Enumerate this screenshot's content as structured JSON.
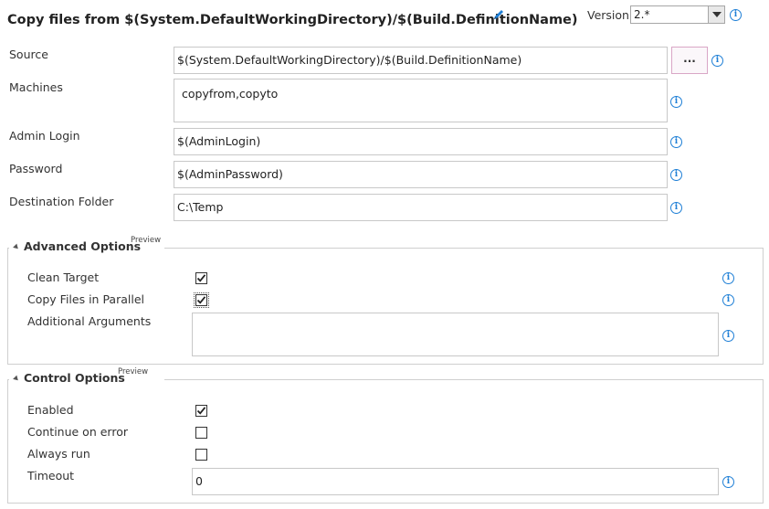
{
  "header": {
    "title": "Copy files from $(System.DefaultWorkingDirectory)/$(Build.DefinitionName)",
    "version_label": "Version",
    "version_value": "2.*"
  },
  "fields": {
    "source": {
      "label": "Source",
      "value": "$(System.DefaultWorkingDirectory)/$(Build.DefinitionName)",
      "browse_label": "..."
    },
    "machines": {
      "label": "Machines",
      "value": "copyfrom,copyto"
    },
    "admin_login": {
      "label": "Admin Login",
      "value": "$(AdminLogin)"
    },
    "password": {
      "label": "Password",
      "value": "$(AdminPassword)"
    },
    "destination": {
      "label": "Destination Folder",
      "value": "C:\\Temp"
    }
  },
  "advanced": {
    "title": "Advanced Options",
    "badge": "Preview",
    "clean_target": {
      "label": "Clean Target",
      "checked": true
    },
    "copy_parallel": {
      "label": "Copy Files in Parallel",
      "checked": true
    },
    "additional_args": {
      "label": "Additional Arguments",
      "value": ""
    }
  },
  "control": {
    "title": "Control Options",
    "badge": "Preview",
    "enabled": {
      "label": "Enabled",
      "checked": true
    },
    "continue_on_error": {
      "label": "Continue on error",
      "checked": false
    },
    "always_run": {
      "label": "Always run",
      "checked": false
    },
    "timeout": {
      "label": "Timeout",
      "value": "0"
    }
  },
  "icons": {
    "info": "info-icon",
    "edit": "pencil-icon",
    "info_glyph": "i"
  },
  "colors": {
    "accent": "#1e7fd6"
  }
}
